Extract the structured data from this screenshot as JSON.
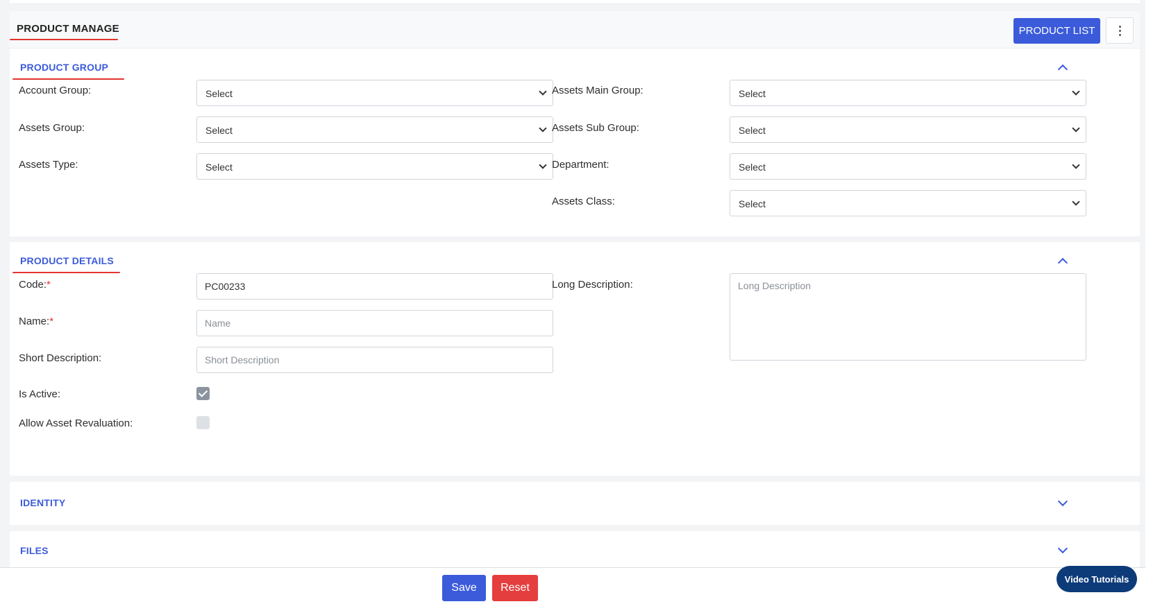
{
  "header": {
    "title": "PRODUCT MANAGE",
    "product_list_label": "PRODUCT LIST",
    "more_icon": "kebab-menu-icon"
  },
  "product_group": {
    "title": "PRODUCT GROUP",
    "fields": {
      "account_group": {
        "label": "Account Group:",
        "value": "Select"
      },
      "assets_main_group": {
        "label": "Assets Main Group:",
        "value": "Select"
      },
      "assets_group": {
        "label": "Assets Group:",
        "value": "Select"
      },
      "assets_sub_group": {
        "label": "Assets Sub Group:",
        "value": "Select"
      },
      "assets_type": {
        "label": "Assets Type:",
        "value": "Select"
      },
      "department": {
        "label": "Department:",
        "value": "Select"
      },
      "assets_class": {
        "label": "Assets Class:",
        "value": "Select"
      }
    }
  },
  "product_details": {
    "title": "PRODUCT DETAILS",
    "code": {
      "label": "Code:",
      "required": "*",
      "value": "PC00233"
    },
    "name": {
      "label": "Name:",
      "required": "*",
      "value": "",
      "placeholder": "Name"
    },
    "short_description": {
      "label": "Short Description:",
      "value": "",
      "placeholder": "Short Description"
    },
    "long_description": {
      "label": "Long Description:",
      "value": "",
      "placeholder": "Long Description"
    },
    "is_active": {
      "label": "Is Active:",
      "checked": true
    },
    "allow_asset_revaluation": {
      "label": "Allow Asset Revaluation:",
      "checked": false
    }
  },
  "identity": {
    "title": "IDENTITY"
  },
  "files": {
    "title": "FILES"
  },
  "footer": {
    "save_label": "Save",
    "reset_label": "Reset",
    "video_label": "Video Tutorials"
  },
  "colors": {
    "accent": "#3b5bdb",
    "danger": "#e53e3e",
    "underline": "#e3342f",
    "video": "#0d3b7a"
  }
}
